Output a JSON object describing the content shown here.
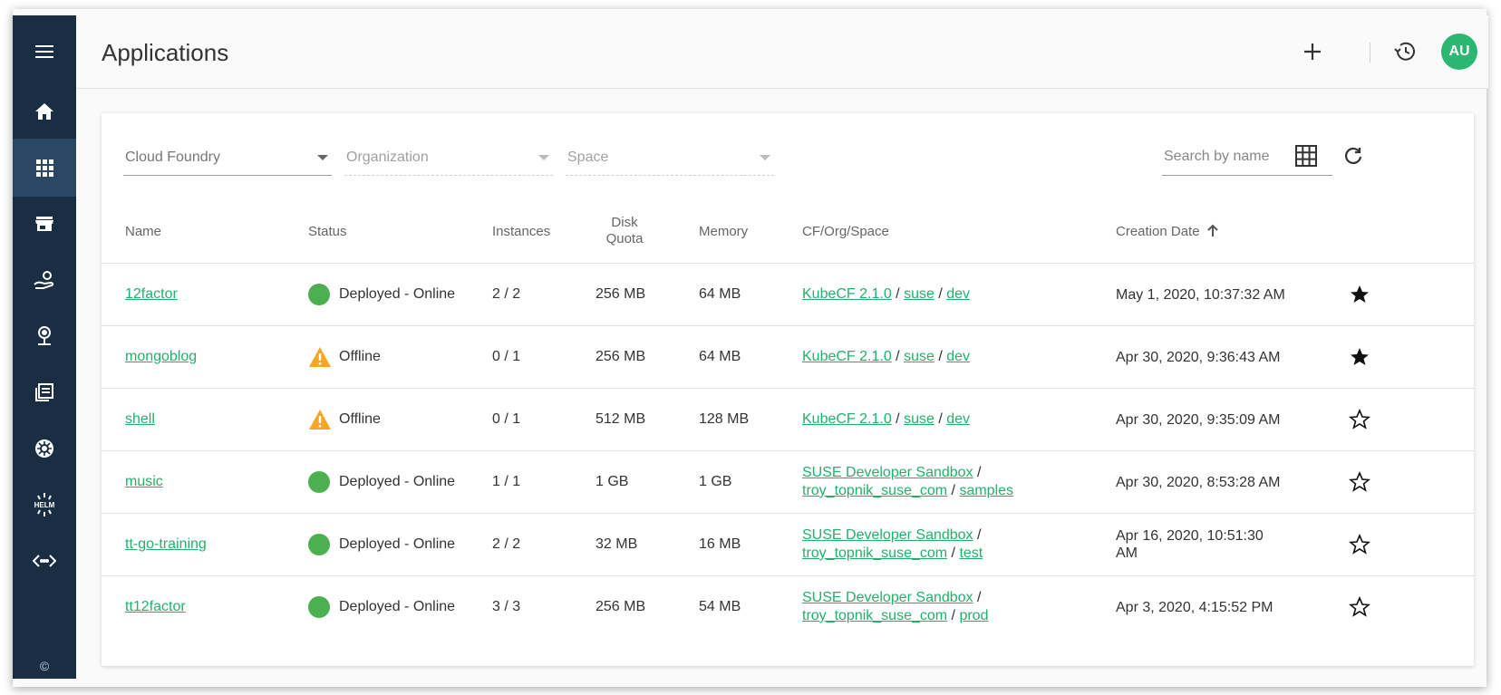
{
  "header": {
    "title": "Applications",
    "avatar_initials": "AU",
    "accent_color": "#2bb672"
  },
  "sidebar": {
    "items": [
      {
        "name": "menu-icon"
      },
      {
        "name": "home-icon"
      },
      {
        "name": "apps-grid-icon",
        "active": true
      },
      {
        "name": "marketplace-icon"
      },
      {
        "name": "services-icon"
      },
      {
        "name": "endpoints-icon"
      },
      {
        "name": "logs-icon"
      },
      {
        "name": "kubernetes-icon"
      },
      {
        "name": "helm-icon"
      },
      {
        "name": "api-icon"
      }
    ],
    "copyright": "©"
  },
  "filters": {
    "cloud_foundry": "Cloud Foundry",
    "organization": "Organization",
    "space": "Space",
    "search_placeholder": "Search by name"
  },
  "table": {
    "columns": {
      "name": "Name",
      "status": "Status",
      "instances": "Instances",
      "disk_quota": "Disk\nQuota",
      "memory": "Memory",
      "cf_org_space": "CF/Org/Space",
      "creation_date": "Creation Date"
    },
    "rows": [
      {
        "name": "12factor",
        "status": "Deployed - Online",
        "state": "online",
        "instances": "2 / 2",
        "disk": "256 MB",
        "memory": "64 MB",
        "cf": "KubeCF 2.1.0",
        "org": "suse",
        "space": "dev",
        "date": "May 1, 2020, 10:37:32 AM",
        "favorite": true
      },
      {
        "name": "mongoblog",
        "status": "Offline",
        "state": "offline",
        "instances": "0 / 1",
        "disk": "256 MB",
        "memory": "64 MB",
        "cf": "KubeCF 2.1.0",
        "org": "suse",
        "space": "dev",
        "date": "Apr 30, 2020, 9:36:43 AM",
        "favorite": true
      },
      {
        "name": "shell",
        "status": "Offline",
        "state": "offline",
        "instances": "0 / 1",
        "disk": "512 MB",
        "memory": "128 MB",
        "cf": "KubeCF 2.1.0",
        "org": "suse",
        "space": "dev",
        "date": "Apr 30, 2020, 9:35:09 AM",
        "favorite": false
      },
      {
        "name": "music",
        "status": "Deployed - Online",
        "state": "online",
        "instances": "1 / 1",
        "disk": "1 GB",
        "memory": "1 GB",
        "cf": "SUSE Developer Sandbox",
        "org": "troy_topnik_suse_com",
        "space": "samples",
        "date": "Apr 30, 2020, 8:53:28 AM",
        "favorite": false
      },
      {
        "name": "tt-go-training",
        "status": "Deployed - Online",
        "state": "online",
        "instances": "2 / 2",
        "disk": "32 MB",
        "memory": "16 MB",
        "cf": "SUSE Developer Sandbox",
        "org": "troy_topnik_suse_com",
        "space": "test",
        "date": "Apr 16, 2020, 10:51:30 AM",
        "favorite": false
      },
      {
        "name": "tt12factor",
        "status": "Deployed - Online",
        "state": "online",
        "instances": "3 / 3",
        "disk": "256 MB",
        "memory": "54 MB",
        "cf": "SUSE Developer Sandbox",
        "org": "troy_topnik_suse_com",
        "space": "prod",
        "date": "Apr 3, 2020, 4:15:52 PM",
        "favorite": false
      }
    ]
  },
  "colors": {
    "sidebar_bg": "#1a2e43",
    "link": "#23b06a",
    "online": "#4caf50",
    "warning": "#f5a623"
  }
}
